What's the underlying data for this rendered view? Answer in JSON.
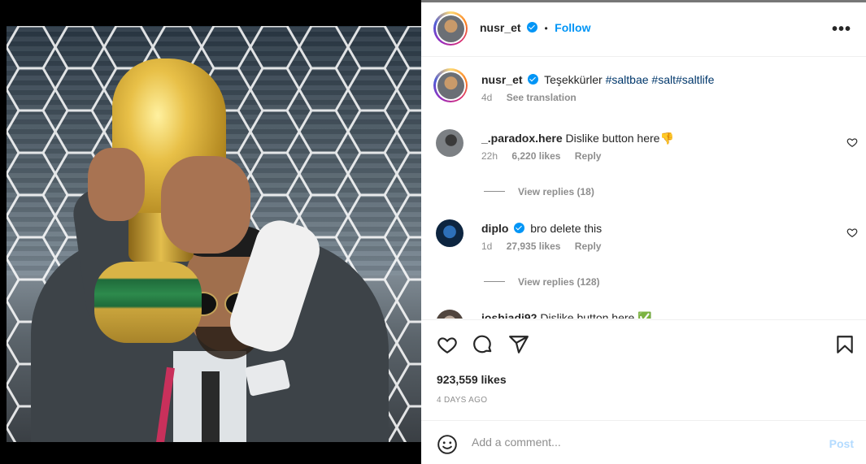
{
  "post": {
    "username": "nusr_et",
    "follow_label": "Follow",
    "dot": "•",
    "more_label": "•••"
  },
  "caption": {
    "username": "nusr_et",
    "text": "Teşekkürler",
    "hashtags": [
      "#saltbae",
      "#salt",
      "#saltlife"
    ],
    "age": "4d",
    "see_translation": "See translation"
  },
  "comments": [
    {
      "username": "_.paradox.here",
      "text": "Dislike button here👎",
      "age": "22h",
      "likes": "6,220 likes",
      "reply": "Reply",
      "view_replies": "View replies (18)"
    },
    {
      "username": "diplo",
      "verified": true,
      "text": "bro delete this",
      "age": "1d",
      "likes": "27,935 likes",
      "reply": "Reply",
      "view_replies": "View replies (128)"
    },
    {
      "username": "joshiadi92",
      "text": "Dislike button here ✅"
    }
  ],
  "actions": {
    "like_count": "923,559 likes",
    "time_ago": "4 DAYS AGO"
  },
  "comment_box": {
    "placeholder": "Add a comment...",
    "post_label": "Post"
  },
  "colors": {
    "accent": "#0095f6",
    "hashtag": "#00376b",
    "muted": "#8e8e8e",
    "post_disabled": "#b3dbff"
  }
}
